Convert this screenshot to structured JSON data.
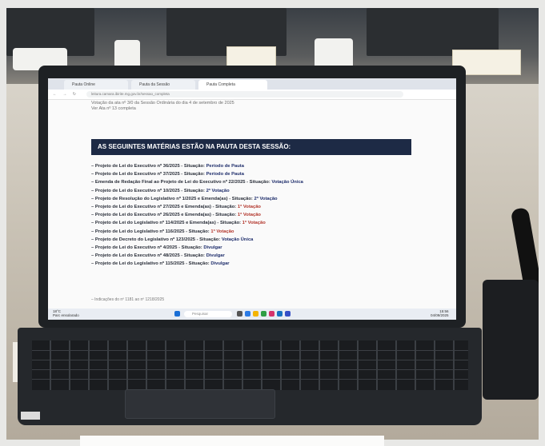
{
  "browser": {
    "tabs": [
      "Pauta Online",
      "Pauta da Sessão",
      "Pauta Completa"
    ],
    "url": "leitura.camara.ibirite.mg.gov.br/sessao_completa"
  },
  "document": {
    "intro_line1": "Votação da ata nº 3/0 da Sessão Ordinária do dia 4 de setembro de 2025",
    "intro_line2": "Ver Ata nº 13 completa",
    "banner_title": "AS SEGUINTES MATÉRIAS ESTÃO NA PAUTA DESTA SESSÃO:",
    "items": [
      {
        "text": "– Projeto de Lei do Executivo nº 36/2025 - Situação:",
        "status": "Período de Pauta",
        "red": false
      },
      {
        "text": "– Projeto de Lei do Executivo nº 37/2025 - Situação:",
        "status": "Período de Pauta",
        "red": false
      },
      {
        "text": "– Emenda de Redação Final ao Projeto de Lei do Executivo nº 22/2025 - Situação:",
        "status": "Votação Única",
        "red": false
      },
      {
        "text": "– Projeto de Lei do Executivo nº 10/2025 - Situação:",
        "status": "2ª Votação",
        "red": false
      },
      {
        "text": "– Projeto de Resolução do Legislativo nº 1/2025 e Emenda(as) - Situação:",
        "status": "2ª Votação",
        "red": false
      },
      {
        "text": "– Projeto de Lei do Executivo nº 27/2025 e Emenda(as) - Situação:",
        "status": "1ª Votação",
        "red": true
      },
      {
        "text": "– Projeto de Lei do Executivo nº 26/2025 e Emenda(as) - Situação:",
        "status": "1ª Votação",
        "red": true
      },
      {
        "text": "– Projeto de Lei do Legislativo nº 114/2025 e Emenda(as) - Situação:",
        "status": "1ª Votação",
        "red": true
      },
      {
        "text": "– Projeto de Lei do Legislativo nº 116/2025 - Situação:",
        "status": "1ª Votação",
        "red": true
      },
      {
        "text": "– Projeto de Decreto do Legislativo nº 123/2025 - Situação:",
        "status": "Votação Única",
        "red": false
      },
      {
        "text": "– Projeto de Lei do Executivo nº 4/2025 - Situação:",
        "status": "Divulgar",
        "red": false
      },
      {
        "text": "– Projeto de Lei do Executivo nº 48/2025 - Situação:",
        "status": "Divulgar",
        "red": false
      },
      {
        "text": "– Projeto de Lei do Legislativo nº 115/2025 - Situação:",
        "status": "Divulgar",
        "red": false
      }
    ],
    "footnote": "– Indicações do nº 1181 ao nº 1218/2025"
  },
  "taskbar": {
    "weather": "18°C",
    "weather_desc": "Parc ensolarado",
    "search_placeholder": "Pesquisar",
    "time": "15:56",
    "date": "04/09/2025"
  },
  "colors": {
    "banner": "#1d2a45",
    "status_blue": "#1e2d6b",
    "status_red": "#b2352b"
  }
}
